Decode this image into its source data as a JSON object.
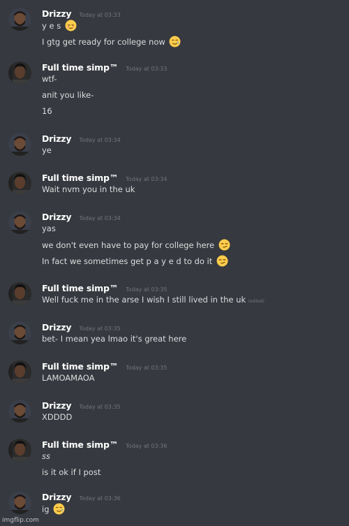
{
  "messages": [
    {
      "author": "Drizzy",
      "time": "Today at 03:33",
      "lines": [
        {
          "text": "y e s",
          "emoji": "relieved-face-icon"
        },
        {
          "text": "I gtg get ready for college now",
          "emoji": "smiling-face-with-tear-icon"
        }
      ]
    },
    {
      "author": "Full time simp™",
      "time": "Today at 03:33",
      "lines": [
        {
          "text": "wtf-"
        },
        {
          "text": "anit you like-"
        },
        {
          "text": "16"
        }
      ]
    },
    {
      "author": "Drizzy",
      "time": "Today at 03:34",
      "lines": [
        {
          "text": "ye"
        }
      ]
    },
    {
      "author": "Full time simp™",
      "time": "Today at 03:34",
      "lines": [
        {
          "text": "Wait nvm you in the uk"
        }
      ]
    },
    {
      "author": "Drizzy",
      "time": "Today at 03:34",
      "lines": [
        {
          "text": "yas"
        },
        {
          "text": "we don't even have to pay for college here",
          "emoji": "smirking-face-icon"
        },
        {
          "text": "In fact we sometimes get p a y e d to do it",
          "emoji": "smirking-face-icon"
        }
      ]
    },
    {
      "author": "Full time simp™",
      "time": "Today at 03:35",
      "lines": [
        {
          "text": "Well fuck me in the arse I wish I still lived in the uk",
          "edited": "(edited)"
        }
      ]
    },
    {
      "author": "Drizzy",
      "time": "Today at 03:35",
      "lines": [
        {
          "text": "bet- I mean yea lmao it's great here"
        }
      ]
    },
    {
      "author": "Full time simp™",
      "time": "Today at 03:35",
      "lines": [
        {
          "text": "LAMOAMAOA"
        }
      ]
    },
    {
      "author": "Drizzy",
      "time": "Today at 03:35",
      "lines": [
        {
          "text": "XDDDD"
        }
      ]
    },
    {
      "author": "Full time simp™",
      "time": "Today at 03:36",
      "lines": [
        {
          "text": "ss",
          "italic": true
        },
        {
          "text": "is it ok if I post"
        }
      ]
    },
    {
      "author": "Drizzy",
      "time": "Today at 03:36",
      "lines": [
        {
          "text": "ig",
          "emoji": "smiling-face-with-tear-icon"
        }
      ]
    }
  ],
  "watermark": "imgflip.com",
  "colors": {
    "background": "#36393f",
    "username": "#ffffff",
    "timestamp": "#72767d",
    "text": "#dcddde"
  }
}
